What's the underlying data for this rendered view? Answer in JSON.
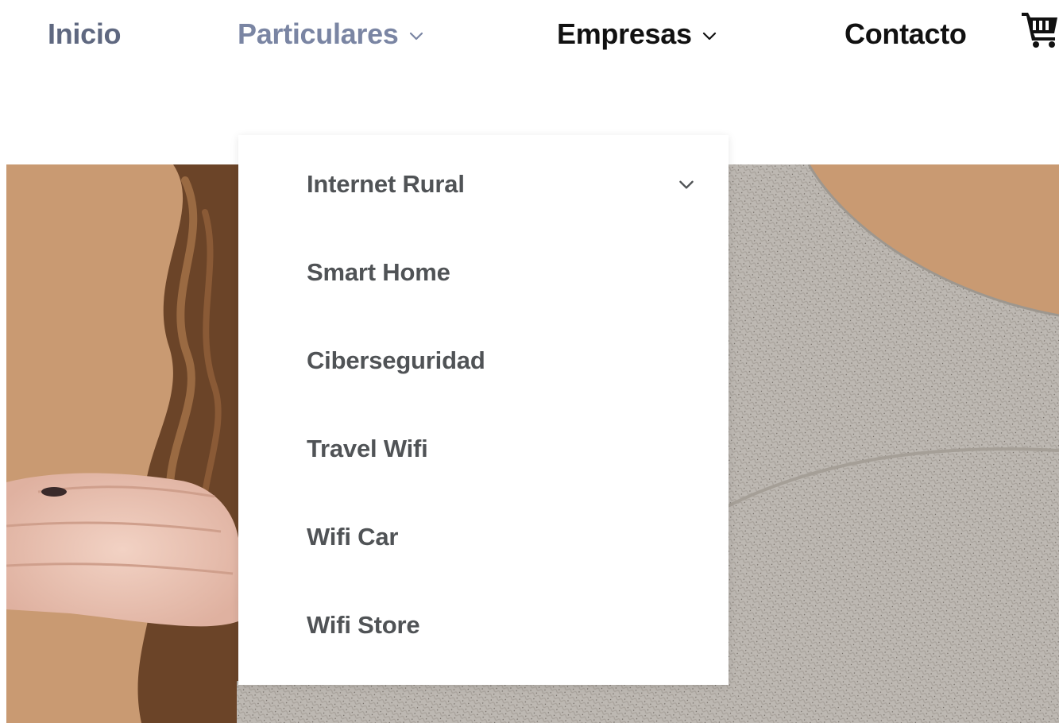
{
  "nav": {
    "items": [
      {
        "label": "Inicio"
      },
      {
        "label": "Particulares",
        "icon": "chevron-down-icon"
      },
      {
        "label": "Empresas",
        "icon": "chevron-down-icon"
      },
      {
        "label": "Contacto"
      }
    ],
    "cart_icon": "cart-icon",
    "colors": {
      "inicio": "#5f6880",
      "active": "#7a85a3",
      "default": "#111111"
    }
  },
  "dropdown": {
    "items": [
      {
        "label": "Internet Rural",
        "icon": "chevron-down-icon"
      },
      {
        "label": "Smart Home"
      },
      {
        "label": "Ciberseguridad"
      },
      {
        "label": "Travel Wifi"
      },
      {
        "label": "Wifi Car"
      },
      {
        "label": "Wifi Store"
      }
    ],
    "text_color": "#505356"
  },
  "hero": {
    "background_color": "#c99a72",
    "sweater_color": "#bdb8b2"
  }
}
